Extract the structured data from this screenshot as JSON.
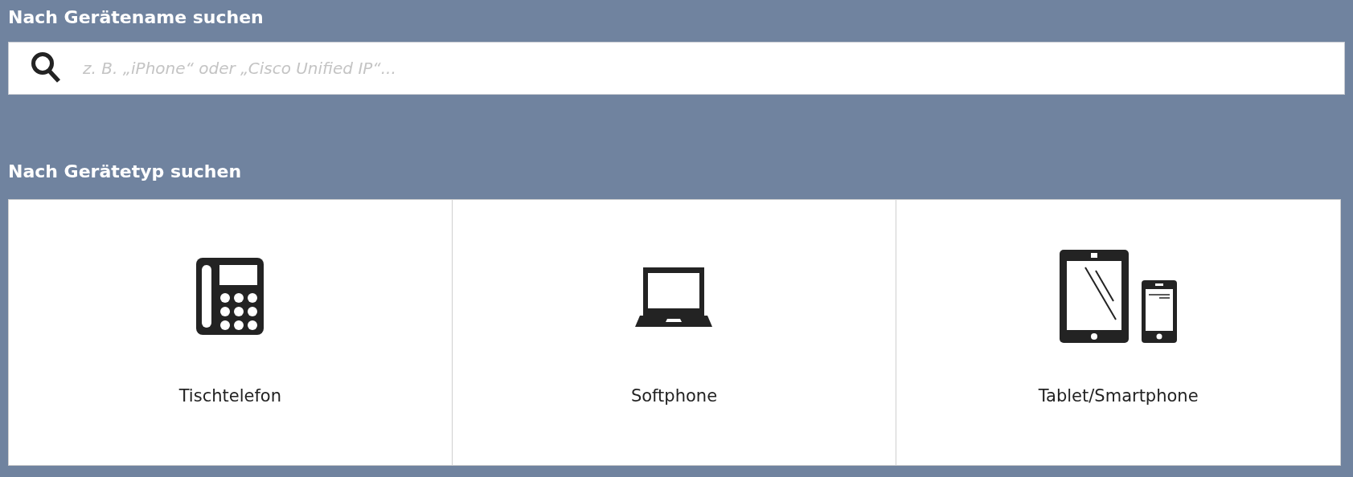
{
  "name_search": {
    "heading": "Nach Gerätename suchen",
    "placeholder": "z. B. „iPhone“ oder „Cisco Unified IP“..."
  },
  "type_search": {
    "heading": "Nach Gerätetyp suchen",
    "types": [
      {
        "kind": "deskphone",
        "label": "Tischtelefon"
      },
      {
        "kind": "laptop",
        "label": "Softphone"
      },
      {
        "kind": "mobile",
        "label": "Tablet/Smartphone"
      }
    ]
  }
}
